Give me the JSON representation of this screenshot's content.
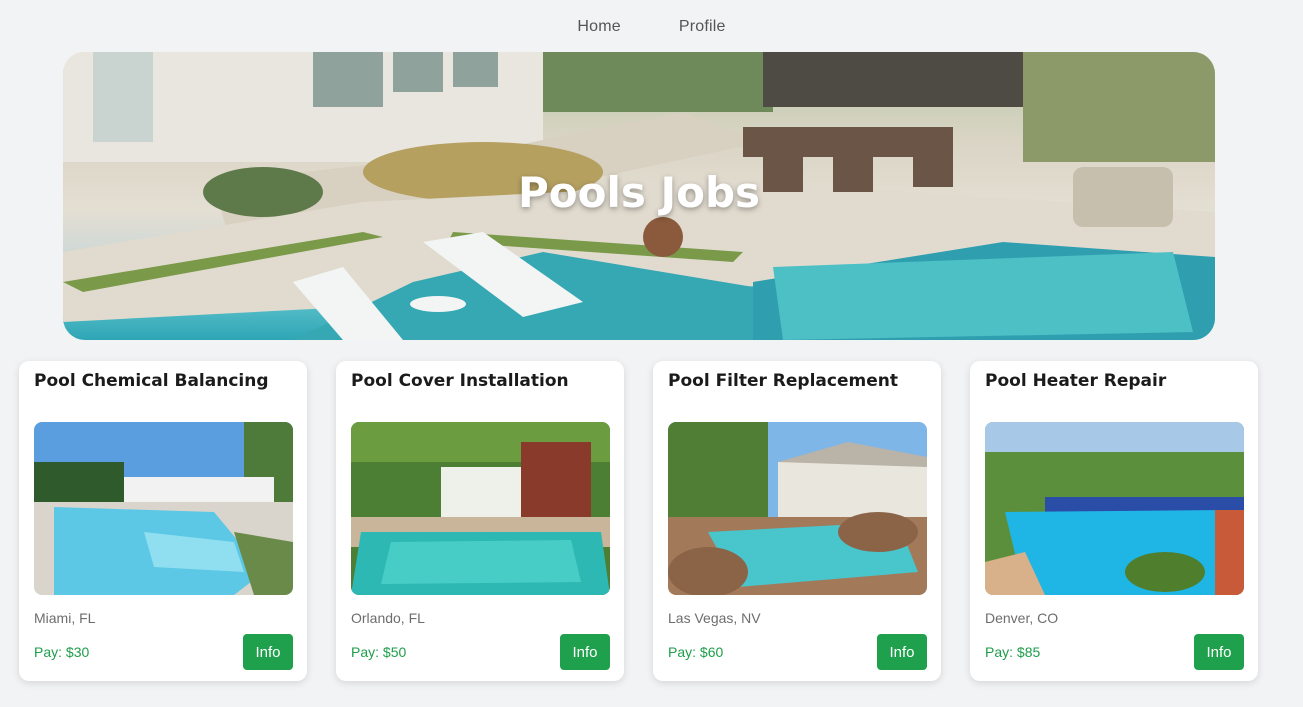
{
  "nav": {
    "home": "Home",
    "profile": "Profile"
  },
  "hero": {
    "title": "Pools Jobs"
  },
  "jobs": [
    {
      "title": "Pool Chemical Balancing",
      "location": "Miami, FL",
      "pay": "Pay: $30",
      "button": "Info"
    },
    {
      "title": "Pool Cover Installation",
      "location": "Orlando, FL",
      "pay": "Pay: $50",
      "button": "Info"
    },
    {
      "title": "Pool Filter Replacement",
      "location": "Las Vegas, NV",
      "pay": "Pay: $60",
      "button": "Info"
    },
    {
      "title": "Pool Heater Repair",
      "location": "Denver, CO",
      "pay": "Pay: $85",
      "button": "Info"
    }
  ],
  "colors": {
    "accent": "#1ea04c",
    "pay_text": "#1e9e4a",
    "background": "#f2f3f5"
  }
}
